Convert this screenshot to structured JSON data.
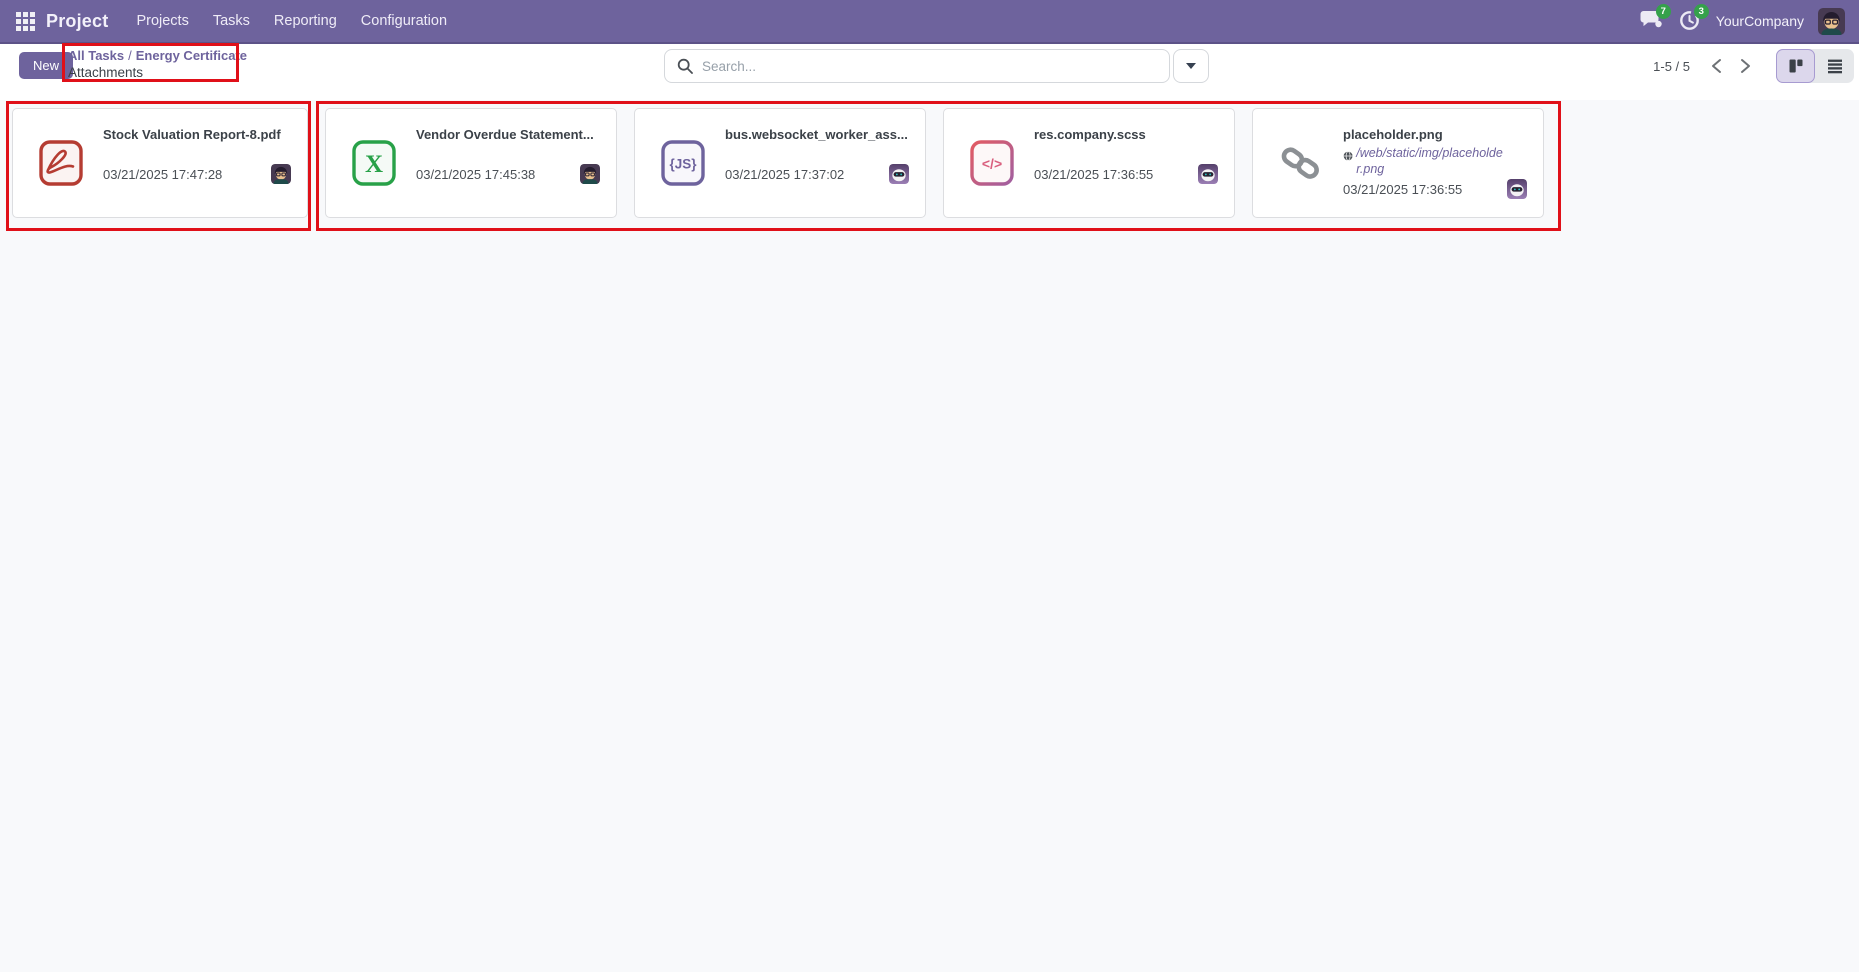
{
  "colors": {
    "accent_purple": "#6e639d",
    "annotation_red": "#e01019",
    "badge_green": "#35a14b",
    "pdf_red": "#b53c32",
    "xlsx_green": "#28a148",
    "content_bg": "#f8f9fb"
  },
  "topbar": {
    "app_name": "Project",
    "menus": [
      "Projects",
      "Tasks",
      "Reporting",
      "Configuration"
    ],
    "messages_badge": "7",
    "activities_badge": "3",
    "company_name": "YourCompany"
  },
  "control_panel": {
    "new_button_label": "New",
    "breadcrumb": {
      "link_1": "All Tasks",
      "separator": "/",
      "link_2": "Energy Certificate",
      "active": "Attachments"
    },
    "search_placeholder": "Search...",
    "pager_value": "1-5 / 5"
  },
  "icon_glyphs": {
    "xlsx": "X",
    "javascript": "{JS}",
    "scss": "</>"
  },
  "cards": [
    {
      "title": "Stock Valuation Report-8.pdf",
      "date": "03/21/2025 17:47:28",
      "file_type": "pdf",
      "owner": "user"
    },
    {
      "title": "Vendor Overdue Statement...",
      "date": "03/21/2025 17:45:38",
      "file_type": "xlsx",
      "owner": "user"
    },
    {
      "title": "bus.websocket_worker_ass...",
      "date": "03/21/2025 17:37:02",
      "file_type": "javascript",
      "owner": "bot"
    },
    {
      "title": "res.company.scss",
      "date": "03/21/2025 17:36:55",
      "file_type": "scss",
      "owner": "bot"
    },
    {
      "title": "placeholder.png",
      "url": "/web/static/img/placeholder.png",
      "date": "03/21/2025 17:36:55",
      "file_type": "link",
      "owner": "bot"
    }
  ]
}
